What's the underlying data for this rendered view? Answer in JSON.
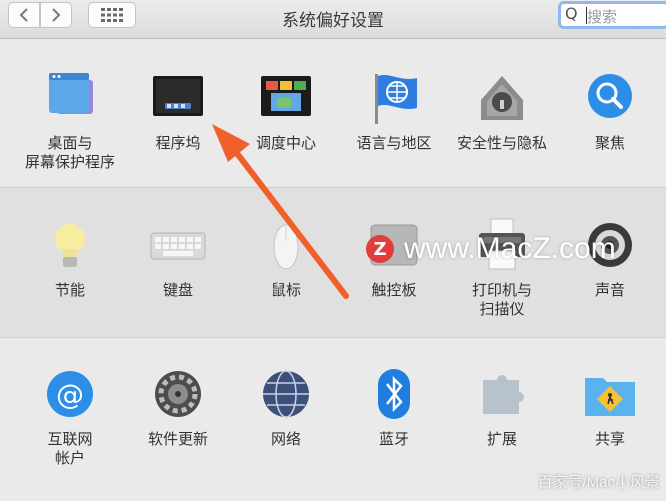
{
  "window": {
    "title": "系统偏好设置"
  },
  "toolbar": {
    "back_icon": "chevron-left-icon",
    "forward_icon": "chevron-right-icon",
    "grid_icon": "grid-icon"
  },
  "search": {
    "glyph": "Q",
    "placeholder": "搜索"
  },
  "sections": [
    {
      "items": [
        {
          "label": "桌面与\n屏幕保护程序",
          "icon": "desktop-screensaver-icon"
        },
        {
          "label": "程序坞",
          "icon": "dock-icon"
        },
        {
          "label": "调度中心",
          "icon": "mission-control-icon"
        },
        {
          "label": "语言与地区",
          "icon": "language-region-icon"
        },
        {
          "label": "安全性与隐私",
          "icon": "security-privacy-icon"
        },
        {
          "label": "聚焦",
          "icon": "spotlight-icon"
        }
      ]
    },
    {
      "items": [
        {
          "label": "节能",
          "icon": "energy-saver-icon"
        },
        {
          "label": "键盘",
          "icon": "keyboard-icon"
        },
        {
          "label": "鼠标",
          "icon": "mouse-icon"
        },
        {
          "label": "触控板",
          "icon": "trackpad-icon"
        },
        {
          "label": "打印机与\n扫描仪",
          "icon": "printer-scanner-icon"
        },
        {
          "label": "声音",
          "icon": "sound-icon"
        }
      ]
    },
    {
      "items": [
        {
          "label": "互联网\n帐户",
          "icon": "internet-accounts-icon"
        },
        {
          "label": "软件更新",
          "icon": "software-update-icon"
        },
        {
          "label": "网络",
          "icon": "network-icon"
        },
        {
          "label": "蓝牙",
          "icon": "bluetooth-icon"
        },
        {
          "label": "扩展",
          "icon": "extensions-icon"
        },
        {
          "label": "共享",
          "icon": "sharing-icon"
        }
      ]
    }
  ],
  "watermark": {
    "site_letter": "Z",
    "site": "www.MacZ.com",
    "credit": "百家号/Mac小风景"
  },
  "colors": {
    "accent": "#2f7de0",
    "arrow": "#f0602a",
    "search_focus": "#8fb8ee"
  }
}
